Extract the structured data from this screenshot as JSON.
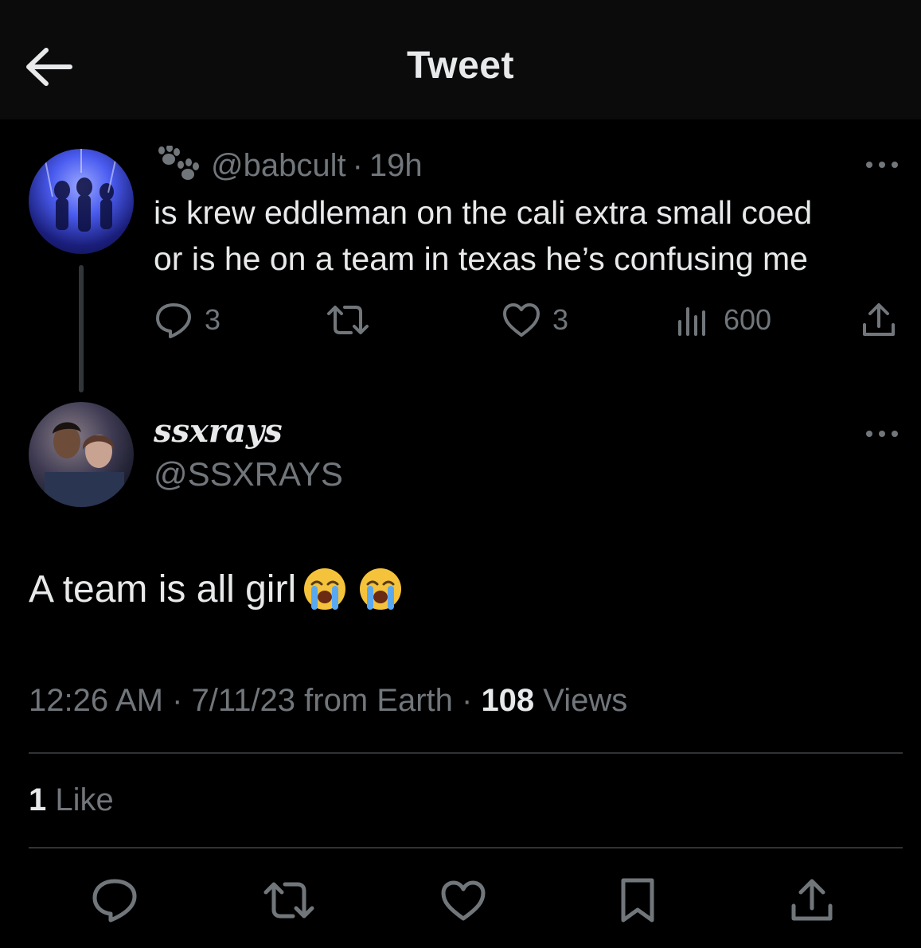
{
  "header": {
    "title": "Tweet",
    "back_icon": "arrow-left-icon"
  },
  "parent_tweet": {
    "handle": "@babcult",
    "separator": "·",
    "time": "19h",
    "text_line1": "is krew eddleman on the cali extra small coed",
    "text_line2": "or is he on a team in texas he’s confusing me",
    "replies": "3",
    "likes": "3",
    "views": "600",
    "name_icon": "paw-prints-icon"
  },
  "reply_tweet": {
    "display_name": "ssxrays",
    "handle": "@SSXRAYS",
    "text": "A team is all girl",
    "emojis": [
      "loudly-crying-face-icon",
      "loudly-crying-face-icon"
    ],
    "time": "12:26 AM",
    "sep1": " · ",
    "date_source": "7/11/23 from Earth",
    "sep2": " · ",
    "views_count": "108",
    "views_label": " Views",
    "likes_count": "1",
    "likes_label": " Like"
  },
  "colors": {
    "background": "#000000",
    "text": "#e7e9ea",
    "muted": "#71767b",
    "divider": "#2f3336"
  }
}
